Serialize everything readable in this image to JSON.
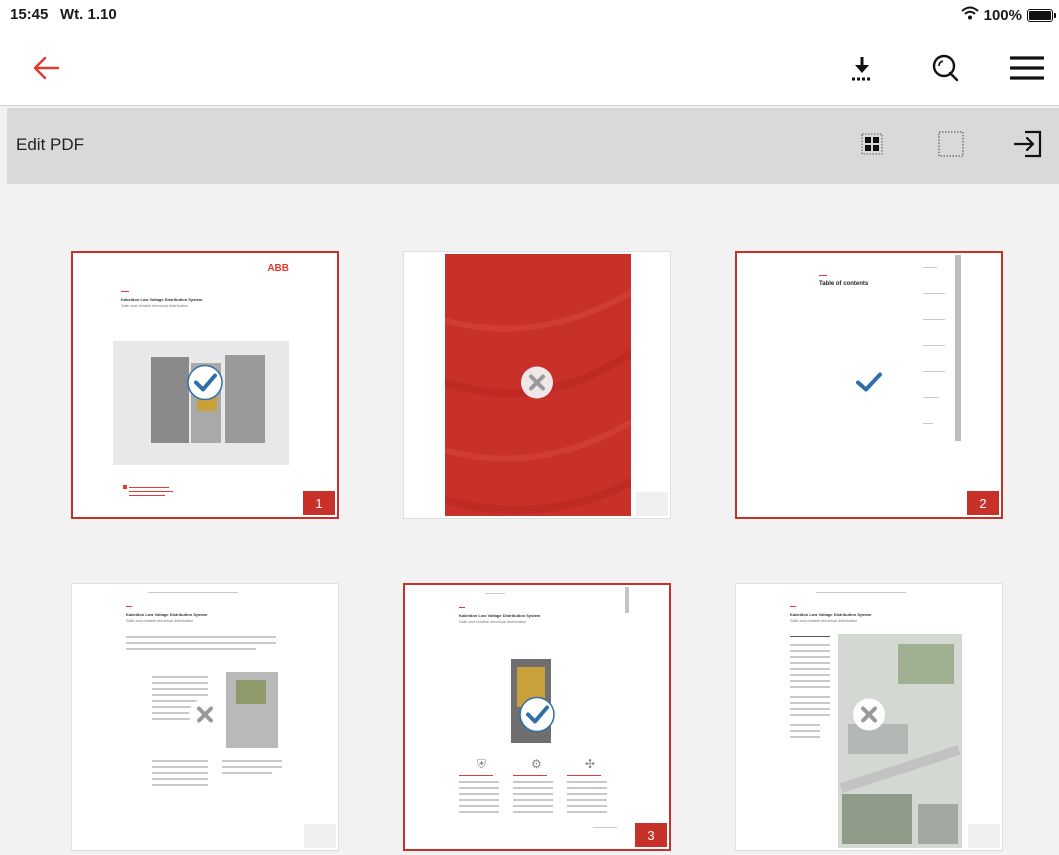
{
  "status": {
    "time": "15:45",
    "date": "Wt. 1.10",
    "battery": "100%",
    "battery_level": 1.0
  },
  "navbar": {
    "back_icon": "arrow-left-icon",
    "download_icon": "download-icon",
    "search_icon": "search-icon",
    "menu_icon": "hamburger-menu-icon"
  },
  "editbar": {
    "title": "Edit PDF",
    "select_all_icon": "grid-select-all-icon",
    "deselect_icon": "dotted-square-icon",
    "export_icon": "export-icon"
  },
  "pages": [
    {
      "state": "selected",
      "number": "1",
      "brand": "ABB",
      "title": "Kabeldon Low Voltage Distribution System",
      "subtitle": "Safe and reliable electrical distribution"
    },
    {
      "state": "excluded",
      "number": ""
    },
    {
      "state": "selected",
      "number": "2",
      "title": "Table of contents"
    },
    {
      "state": "excluded",
      "number": "",
      "title": "Kabeldon Low Voltage Distribution System",
      "subtitle": "Safe and reliable electrical distribution"
    },
    {
      "state": "selected",
      "number": "3",
      "title": "Kabeldon Low Voltage Distribution System",
      "subtitle": "Safe and reliable electrical distribution"
    },
    {
      "state": "excluded",
      "number": "",
      "title": "Kabeldon Low Voltage Distribution System",
      "subtitle": "Safe and reliable electrical distribution"
    }
  ],
  "colors": {
    "accent": "#c8302a",
    "check": "#2f6ea8"
  }
}
